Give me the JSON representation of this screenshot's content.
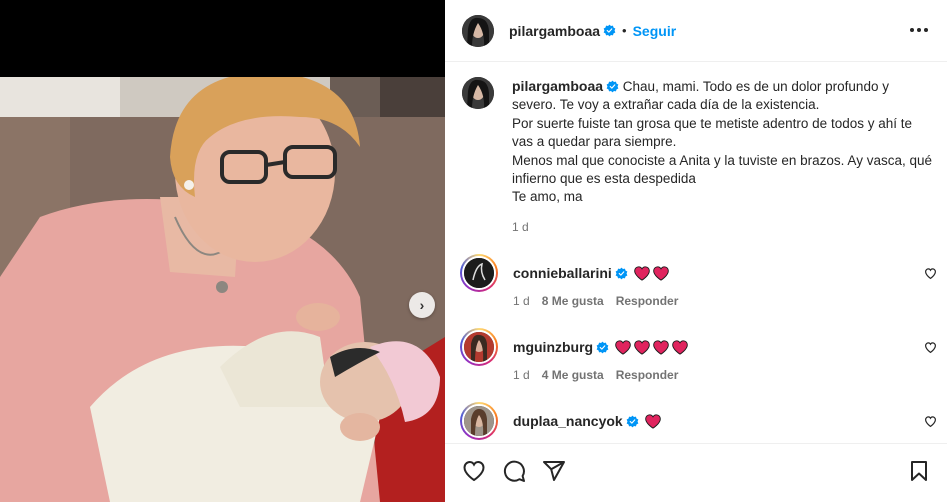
{
  "post": {
    "author": "pilargamboaa",
    "follow_label": "Seguir",
    "separator": "•",
    "caption": "Chau, mami. Todo es de un dolor profundo y severo. Te voy a extrañar cada día de la existencia.\nPor suerte fuiste tan grosa que te metiste adentro de todos y ahí te vas a quedar para siempre.\nMenos mal que conociste a Anita y la tuviste en brazos. Ay vasca, qué infierno que es esta despedida\nTe amo, ma",
    "caption_time": "1 d"
  },
  "comments": [
    {
      "user": "connieballarini",
      "hearts": 2,
      "time": "1 d",
      "likes": "8 Me gusta",
      "reply": "Responder"
    },
    {
      "user": "mguinzburg",
      "hearts": 4,
      "time": "1 d",
      "likes": "4 Me gusta",
      "reply": "Responder"
    },
    {
      "user": "duplaa_nancyok",
      "hearts": 1
    }
  ],
  "icons": {
    "verified": "verified-badge-icon",
    "more": "more-options-icon",
    "next": "chevron-right-icon",
    "like": "heart-outline-icon",
    "comment": "comment-bubble-icon",
    "share": "paper-plane-icon",
    "save": "bookmark-icon"
  },
  "colors": {
    "link": "#0095f6",
    "heart": "#e0245e",
    "verified": "#0095f6"
  }
}
